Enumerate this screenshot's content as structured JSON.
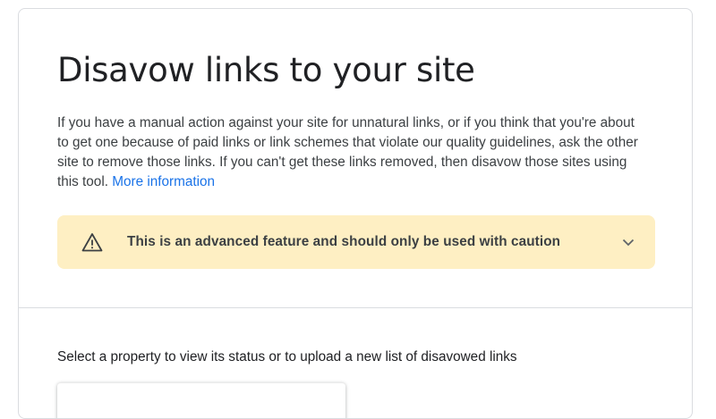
{
  "page": {
    "title": "Disavow links to your site",
    "description_text": "If you have a manual action against your site for unnatural links, or if you think that you're about to get one because of paid links or link schemes that violate our quality guidelines, ask the other site to remove those links. If you can't get these links removed, then disavow those sites using this tool.",
    "more_info_link": "More information"
  },
  "warning": {
    "text": "This is an advanced feature and should only be used with caution",
    "icon": "warning-triangle-icon",
    "expand_icon": "chevron-down-icon",
    "background_color": "#feefc3"
  },
  "property_section": {
    "label": "Select a property to view its status or to upload a new list of disavowed links"
  },
  "colors": {
    "link": "#1a73e8",
    "text": "#202124",
    "border": "#dadce0"
  }
}
